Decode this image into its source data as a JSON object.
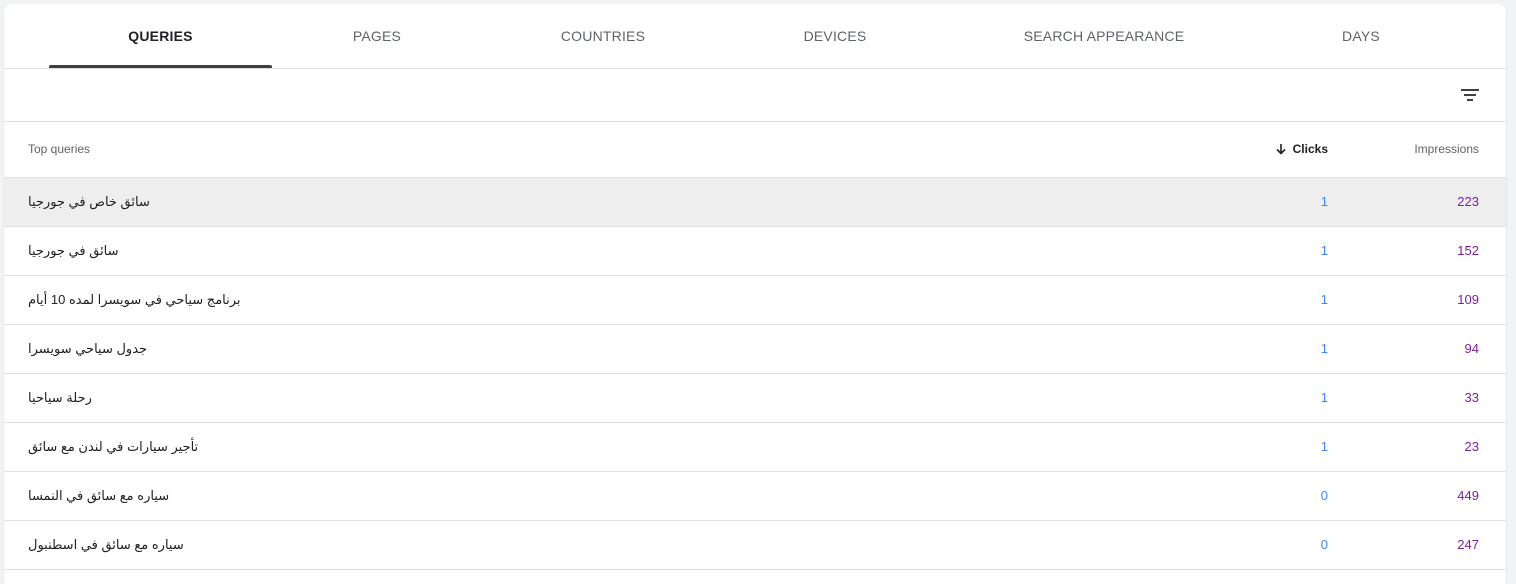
{
  "tabs": [
    {
      "label": "QUERIES",
      "active": true
    },
    {
      "label": "PAGES",
      "active": false
    },
    {
      "label": "COUNTRIES",
      "active": false
    },
    {
      "label": "DEVICES",
      "active": false
    },
    {
      "label": "SEARCH APPEARANCE",
      "active": false
    },
    {
      "label": "DAYS",
      "active": false
    }
  ],
  "toolbar": {
    "filter_icon": "filter-list-icon"
  },
  "table": {
    "headers": {
      "query": "Top queries",
      "clicks": "Clicks",
      "impressions": "Impressions",
      "sort_icon": "arrow-down-icon"
    },
    "rows": [
      {
        "query": "سائق خاص في جورجيا",
        "clicks": "1",
        "impressions": "223"
      },
      {
        "query": "سائق في جورجيا",
        "clicks": "1",
        "impressions": "152"
      },
      {
        "query": "برنامج سياحي في سويسرا لمده 10 أيام",
        "clicks": "1",
        "impressions": "109"
      },
      {
        "query": "جدول سياحي سويسرا",
        "clicks": "1",
        "impressions": "94"
      },
      {
        "query": "رحلة سياحيا",
        "clicks": "1",
        "impressions": "33"
      },
      {
        "query": "تأجير سيارات في لندن مع سائق",
        "clicks": "1",
        "impressions": "23"
      },
      {
        "query": "سياره مع سائق في النمسا",
        "clicks": "0",
        "impressions": "449"
      },
      {
        "query": "سياره مع سائق في اسطنبول",
        "clicks": "0",
        "impressions": "247"
      }
    ]
  },
  "colors": {
    "clicks": "#4285f4",
    "impressions": "#7b1fa2",
    "active_tab_indicator": "#3c4043",
    "hover_row": "#eeeeee"
  }
}
